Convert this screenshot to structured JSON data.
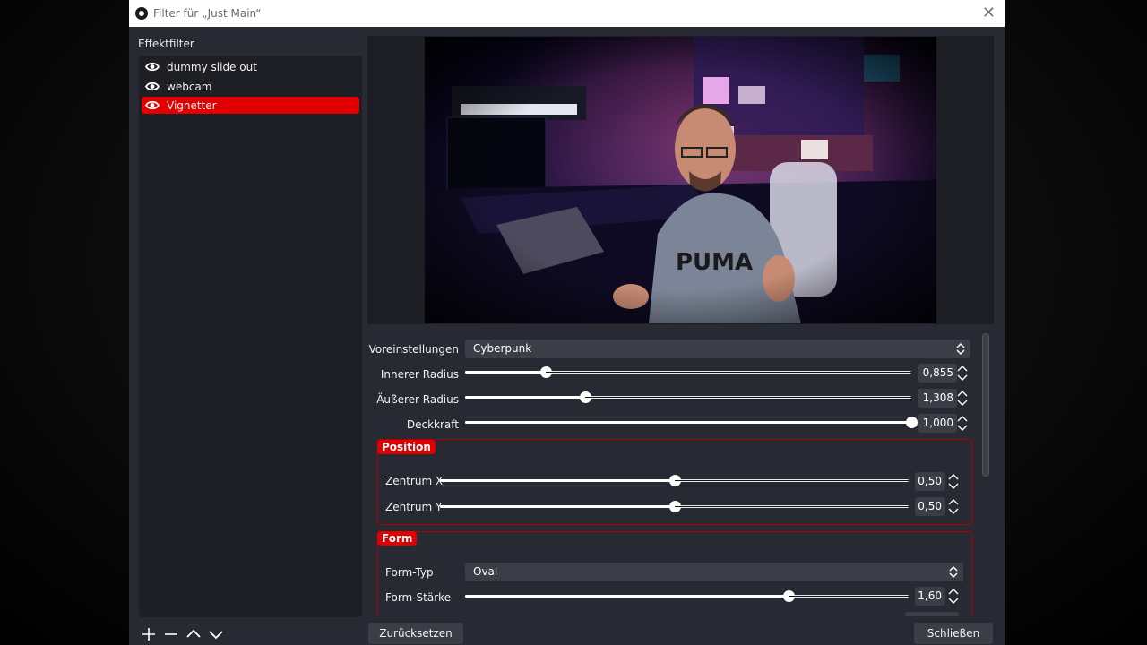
{
  "window": {
    "title": "Filter für „Just Main“",
    "close_glyph": "✕"
  },
  "sidebar": {
    "heading": "Effektfilter",
    "items": [
      {
        "label": "dummy slide out",
        "selected": false
      },
      {
        "label": "webcam",
        "selected": false
      },
      {
        "label": "Vignetter",
        "selected": true
      }
    ],
    "toolbar": {
      "add": "plus-icon",
      "remove": "minus-icon",
      "up": "chevron-up-icon",
      "down": "chevron-down-icon"
    }
  },
  "props": {
    "presets": {
      "label": "Voreinstellungen",
      "value": "Cyberpunk"
    },
    "inner_radius": {
      "label": "Innerer Radius",
      "value": "0,855",
      "level": 0.18
    },
    "outer_radius": {
      "label": "Äußerer Radius",
      "value": "1,308",
      "level": 0.27
    },
    "opacity": {
      "label": "Deckkraft",
      "value": "1,000",
      "level": 1.0
    },
    "position_group": {
      "title": "Position",
      "center_x": {
        "label": "Zentrum X",
        "value": "0,50",
        "level": 0.5
      },
      "center_y": {
        "label": "Zentrum Y",
        "value": "0,50",
        "level": 0.5
      }
    },
    "form_group": {
      "title": "Form",
      "type": {
        "label": "Form-Typ",
        "value": "Oval"
      },
      "strength": {
        "label": "Form-Stärke",
        "value": "1,60",
        "level": 0.73
      }
    }
  },
  "buttons": {
    "reset": "Zurücksetzen",
    "close": "Schließen"
  },
  "colors": {
    "accent": "#e00000",
    "panel": "#272a33",
    "list_bg": "#1e1f25",
    "control": "#3b3e47"
  }
}
